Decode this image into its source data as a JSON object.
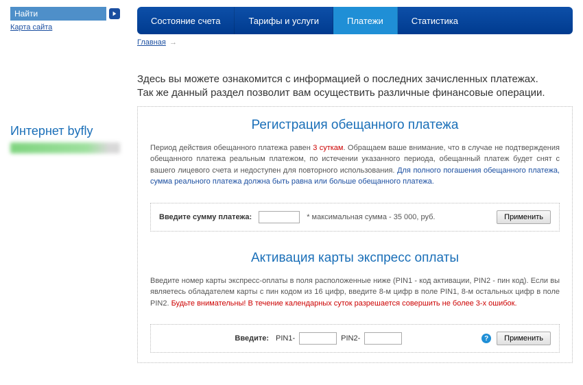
{
  "sidebar": {
    "search_placeholder": "Найти",
    "sitemap_label": "Карта сайта",
    "byfly_title": "Интернет byfly"
  },
  "tabs": {
    "items": [
      {
        "label": "Состояние счета"
      },
      {
        "label": "Тарифы и услуги"
      },
      {
        "label": "Платежи"
      },
      {
        "label": "Статистика"
      }
    ]
  },
  "breadcrumb": {
    "home": "Главная",
    "arrow": "→"
  },
  "intro": {
    "line1": "Здесь вы можете ознакомится с информацией о последних зачисленных платежах.",
    "line2": "Так же данный раздел позволит вам осуществить различные финансовые операции."
  },
  "section1": {
    "title": "Регистрация обещанного платежа",
    "text_before_red": "Период действия обещанного платежа равен ",
    "red_text": "3 суткам",
    "text_after_red": ". Обращаем ваше внимание, что в случае не подтверждения обещанного платежа реальным платежом, по истечении указанного периода, обещанный платеж будет снят с вашего лицевого счета и недоступен для повторного использования. ",
    "blue_text": "Для полного погашения обещанного платежа, сумма реального платежа должна быть равна или больше обещанного платежа.",
    "form_label": "Введите сумму платежа:",
    "max_hint": "* максимальная сумма - 35 000, руб.",
    "apply": "Применить"
  },
  "section2": {
    "title": "Активация карты экспресс оплаты",
    "text_main": "Введите номер карты экспресс-оплаты в поля расположенные ниже (PIN1 - код активации, PIN2 - пин код). Если вы являетесь обладателем карты с пин кодом из 16 цифр, введите 8-м цифр в поле PIN1, 8-м остальных цифр в поле PIN2. ",
    "red_text": "Будьте внимательны! В течение календарных суток разрешается совершить не более 3-х ошибок.",
    "form_label": "Введите:",
    "pin1_label": "PIN1-",
    "pin2_label": "PIN2-",
    "help": "?",
    "apply": "Применить"
  }
}
